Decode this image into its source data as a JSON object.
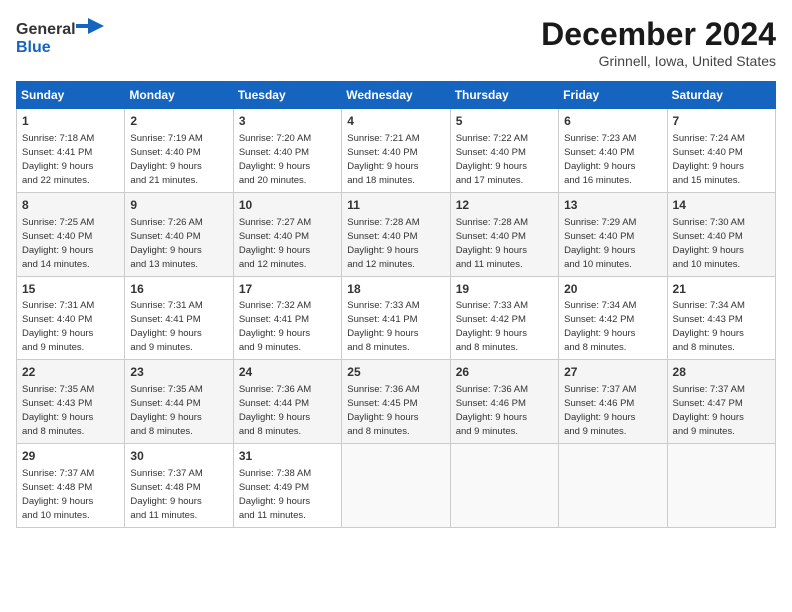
{
  "logo": {
    "general": "General",
    "blue": "Blue"
  },
  "title": {
    "month": "December 2024",
    "location": "Grinnell, Iowa, United States"
  },
  "days_of_week": [
    "Sunday",
    "Monday",
    "Tuesday",
    "Wednesday",
    "Thursday",
    "Friday",
    "Saturday"
  ],
  "weeks": [
    [
      {
        "day": "1",
        "sunrise": "7:18 AM",
        "sunset": "4:41 PM",
        "daylight": "9 hours and 22 minutes."
      },
      {
        "day": "2",
        "sunrise": "7:19 AM",
        "sunset": "4:40 PM",
        "daylight": "9 hours and 21 minutes."
      },
      {
        "day": "3",
        "sunrise": "7:20 AM",
        "sunset": "4:40 PM",
        "daylight": "9 hours and 20 minutes."
      },
      {
        "day": "4",
        "sunrise": "7:21 AM",
        "sunset": "4:40 PM",
        "daylight": "9 hours and 18 minutes."
      },
      {
        "day": "5",
        "sunrise": "7:22 AM",
        "sunset": "4:40 PM",
        "daylight": "9 hours and 17 minutes."
      },
      {
        "day": "6",
        "sunrise": "7:23 AM",
        "sunset": "4:40 PM",
        "daylight": "9 hours and 16 minutes."
      },
      {
        "day": "7",
        "sunrise": "7:24 AM",
        "sunset": "4:40 PM",
        "daylight": "9 hours and 15 minutes."
      }
    ],
    [
      {
        "day": "8",
        "sunrise": "7:25 AM",
        "sunset": "4:40 PM",
        "daylight": "9 hours and 14 minutes."
      },
      {
        "day": "9",
        "sunrise": "7:26 AM",
        "sunset": "4:40 PM",
        "daylight": "9 hours and 13 minutes."
      },
      {
        "day": "10",
        "sunrise": "7:27 AM",
        "sunset": "4:40 PM",
        "daylight": "9 hours and 12 minutes."
      },
      {
        "day": "11",
        "sunrise": "7:28 AM",
        "sunset": "4:40 PM",
        "daylight": "9 hours and 12 minutes."
      },
      {
        "day": "12",
        "sunrise": "7:28 AM",
        "sunset": "4:40 PM",
        "daylight": "9 hours and 11 minutes."
      },
      {
        "day": "13",
        "sunrise": "7:29 AM",
        "sunset": "4:40 PM",
        "daylight": "9 hours and 10 minutes."
      },
      {
        "day": "14",
        "sunrise": "7:30 AM",
        "sunset": "4:40 PM",
        "daylight": "9 hours and 10 minutes."
      }
    ],
    [
      {
        "day": "15",
        "sunrise": "7:31 AM",
        "sunset": "4:40 PM",
        "daylight": "9 hours and 9 minutes."
      },
      {
        "day": "16",
        "sunrise": "7:31 AM",
        "sunset": "4:41 PM",
        "daylight": "9 hours and 9 minutes."
      },
      {
        "day": "17",
        "sunrise": "7:32 AM",
        "sunset": "4:41 PM",
        "daylight": "9 hours and 9 minutes."
      },
      {
        "day": "18",
        "sunrise": "7:33 AM",
        "sunset": "4:41 PM",
        "daylight": "9 hours and 8 minutes."
      },
      {
        "day": "19",
        "sunrise": "7:33 AM",
        "sunset": "4:42 PM",
        "daylight": "9 hours and 8 minutes."
      },
      {
        "day": "20",
        "sunrise": "7:34 AM",
        "sunset": "4:42 PM",
        "daylight": "9 hours and 8 minutes."
      },
      {
        "day": "21",
        "sunrise": "7:34 AM",
        "sunset": "4:43 PM",
        "daylight": "9 hours and 8 minutes."
      }
    ],
    [
      {
        "day": "22",
        "sunrise": "7:35 AM",
        "sunset": "4:43 PM",
        "daylight": "9 hours and 8 minutes."
      },
      {
        "day": "23",
        "sunrise": "7:35 AM",
        "sunset": "4:44 PM",
        "daylight": "9 hours and 8 minutes."
      },
      {
        "day": "24",
        "sunrise": "7:36 AM",
        "sunset": "4:44 PM",
        "daylight": "9 hours and 8 minutes."
      },
      {
        "day": "25",
        "sunrise": "7:36 AM",
        "sunset": "4:45 PM",
        "daylight": "9 hours and 8 minutes."
      },
      {
        "day": "26",
        "sunrise": "7:36 AM",
        "sunset": "4:46 PM",
        "daylight": "9 hours and 9 minutes."
      },
      {
        "day": "27",
        "sunrise": "7:37 AM",
        "sunset": "4:46 PM",
        "daylight": "9 hours and 9 minutes."
      },
      {
        "day": "28",
        "sunrise": "7:37 AM",
        "sunset": "4:47 PM",
        "daylight": "9 hours and 9 minutes."
      }
    ],
    [
      {
        "day": "29",
        "sunrise": "7:37 AM",
        "sunset": "4:48 PM",
        "daylight": "9 hours and 10 minutes."
      },
      {
        "day": "30",
        "sunrise": "7:37 AM",
        "sunset": "4:48 PM",
        "daylight": "9 hours and 11 minutes."
      },
      {
        "day": "31",
        "sunrise": "7:38 AM",
        "sunset": "4:49 PM",
        "daylight": "9 hours and 11 minutes."
      },
      null,
      null,
      null,
      null
    ]
  ],
  "labels": {
    "sunrise": "Sunrise:",
    "sunset": "Sunset:",
    "daylight": "Daylight:"
  }
}
